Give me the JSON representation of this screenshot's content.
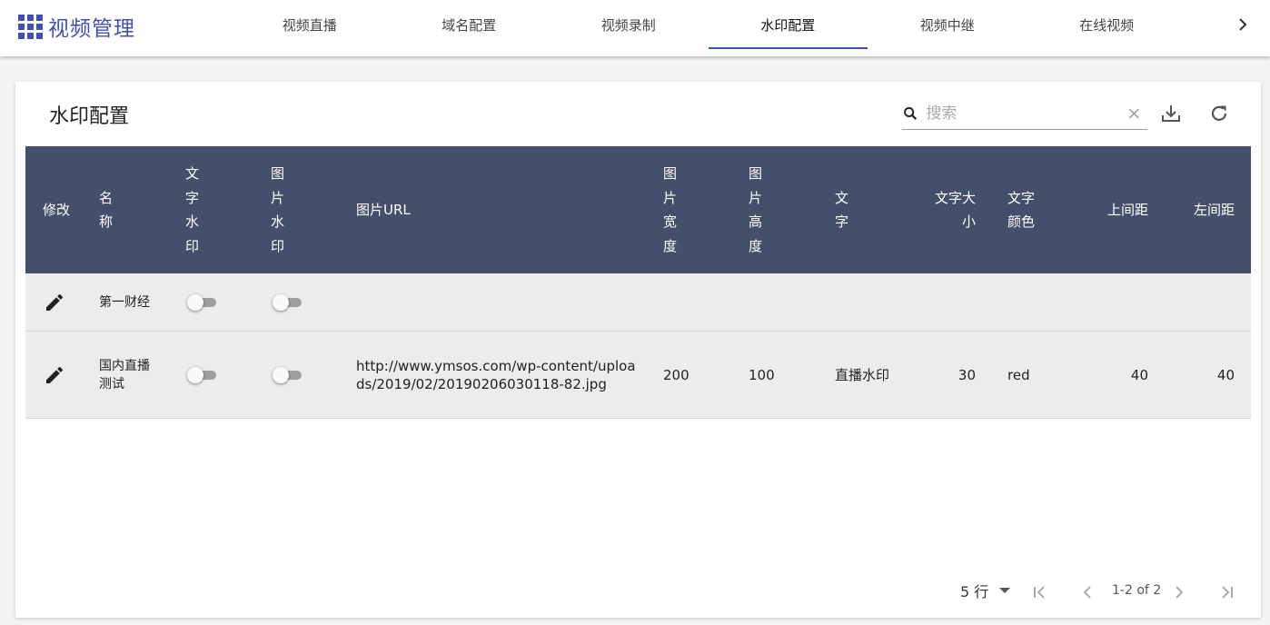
{
  "app": {
    "title": "视频管理"
  },
  "tabs": [
    {
      "label": "视频直播",
      "active": false
    },
    {
      "label": "域名配置",
      "active": false
    },
    {
      "label": "视频录制",
      "active": false
    },
    {
      "label": "水印配置",
      "active": true
    },
    {
      "label": "视频中继",
      "active": false
    },
    {
      "label": "在线视频",
      "active": false
    }
  ],
  "colors": {
    "accent": "#3f51b5",
    "header_bg": "#434f6b",
    "row_bg": "#ececec"
  },
  "page": {
    "title": "水印配置",
    "search": {
      "placeholder": "搜索",
      "value": ""
    },
    "icons": {
      "search": "search-icon",
      "clear": "close-icon",
      "download": "download-icon",
      "refresh": "refresh-icon"
    }
  },
  "table": {
    "columns": [
      "修改",
      "名称",
      "文字水印",
      "图片水印",
      "图片URL",
      "图片宽度",
      "图片高度",
      "文字",
      "文字大小",
      "文字颜色",
      "上间距",
      "左间距"
    ],
    "rows": [
      {
        "name": "第一财经",
        "text_watermark": false,
        "image_watermark": false,
        "image_url": "",
        "image_width": "",
        "image_height": "",
        "text": "",
        "font_size": "",
        "font_color": "",
        "top_margin": "",
        "left_margin": ""
      },
      {
        "name": "国内直播测试",
        "text_watermark": false,
        "image_watermark": false,
        "image_url": "http://www.ymsos.com/wp-content/uploads/2019/02/20190206030118-82.jpg",
        "image_width": "200",
        "image_height": "100",
        "text": "直播水印",
        "font_size": "30",
        "font_color": "red",
        "top_margin": "40",
        "left_margin": "40"
      }
    ]
  },
  "pagination": {
    "rows_per_page": "5 行",
    "range": "1-2 of 2"
  }
}
